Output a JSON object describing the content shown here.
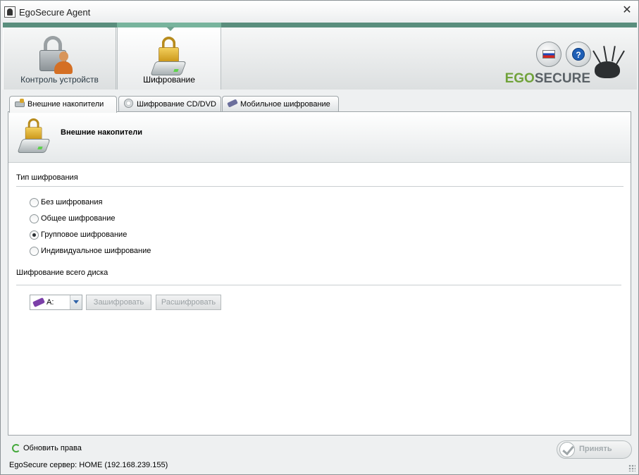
{
  "window": {
    "title": "EgoSecure Agent",
    "close_glyph": "✕"
  },
  "ribbon": {
    "tabs": [
      {
        "label": "Контроль устройств",
        "icon": "lock-user-icon",
        "active": false
      },
      {
        "label": "Шифрование",
        "icon": "lock-drive-icon",
        "active": true
      }
    ],
    "language_icon": "russian-flag-icon",
    "help_glyph": "?",
    "logo": {
      "part1": "EGO",
      "part2": "SECURE"
    },
    "accent_color": "#5a8e7d"
  },
  "subtabs": [
    {
      "label": "Внешние накопители",
      "icon": "external-drive-icon",
      "active": true
    },
    {
      "label": "Шифрование CD/DVD",
      "icon": "cd-icon",
      "active": false
    },
    {
      "label": "Мобильное шифрование",
      "icon": "mobile-encryption-icon",
      "active": false
    }
  ],
  "panel": {
    "title": "Внешние накопители",
    "encryption_type": {
      "label": "Тип шифрования",
      "options": [
        {
          "label": "Без шифрования",
          "checked": false
        },
        {
          "label": "Общее шифрование",
          "checked": false
        },
        {
          "label": "Групповое шифрование",
          "checked": true
        },
        {
          "label": "Индивидуальное шифрование",
          "checked": false
        }
      ]
    },
    "full_disk": {
      "label": "Шифрование всего диска",
      "drive_value": "A:",
      "encrypt_label": "Зашифровать",
      "decrypt_label": "Расшифровать"
    }
  },
  "footer": {
    "refresh_label": "Обновить права",
    "accept_label": "Принять",
    "status": "EgoSecure сервер: HOME (192.168.239.155)"
  }
}
